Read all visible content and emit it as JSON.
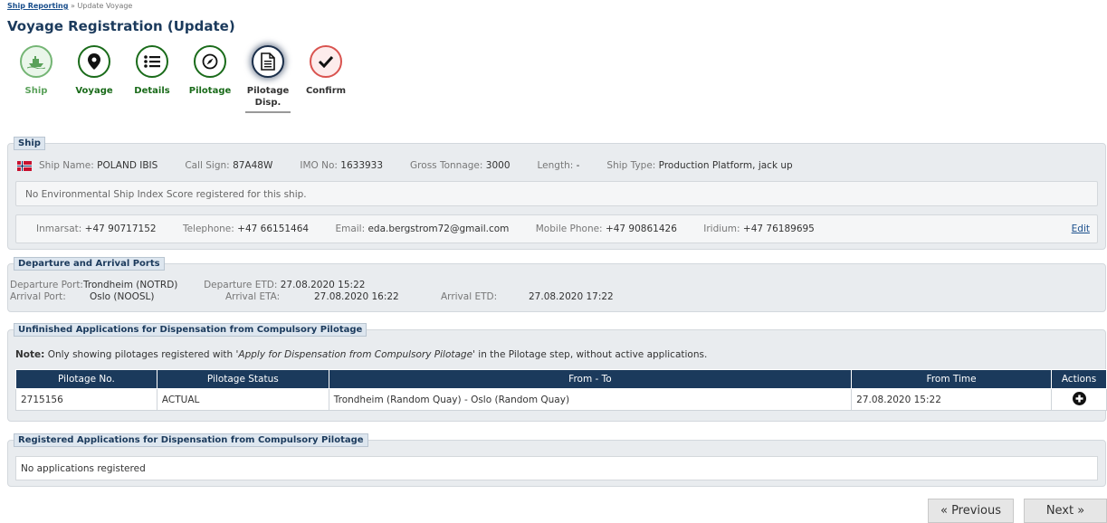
{
  "breadcrumb": {
    "link": "Ship Reporting",
    "separator": "»",
    "current": "Update Voyage"
  },
  "page_title": "Voyage Registration (Update)",
  "steps": [
    {
      "label": "Ship",
      "icon": "ship-icon",
      "state": "done"
    },
    {
      "label": "Voyage",
      "icon": "map-pin-icon",
      "state": "done"
    },
    {
      "label": "Details",
      "icon": "list-icon",
      "state": "done"
    },
    {
      "label": "Pilotage",
      "icon": "compass-icon",
      "state": "done"
    },
    {
      "label": "Pilotage",
      "label2": "Disp.",
      "icon": "document-icon",
      "state": "active"
    },
    {
      "label": "Confirm",
      "icon": "check-icon",
      "state": "pending"
    }
  ],
  "ship": {
    "legend": "Ship",
    "flag": "norway-flag",
    "name_k": "Ship Name:",
    "name_v": "POLAND IBIS",
    "call_k": "Call Sign:",
    "call_v": "87A48W",
    "imo_k": "IMO No:",
    "imo_v": "1633933",
    "gt_k": "Gross Tonnage:",
    "gt_v": "3000",
    "len_k": "Length:",
    "len_v": "-",
    "type_k": "Ship Type:",
    "type_v": "Production Platform, jack up",
    "env_note": "No Environmental Ship Index Score registered for this ship.",
    "inm_k": "Inmarsat:",
    "inm_v": "+47 90717152",
    "tel_k": "Telephone:",
    "tel_v": "+47 66151464",
    "email_k": "Email:",
    "email_v": "eda.bergstrom72@gmail.com",
    "mob_k": "Mobile Phone:",
    "mob_v": "+47 90861426",
    "iri_k": "Iridium:",
    "iri_v": "+47 76189695",
    "edit": "Edit"
  },
  "ports": {
    "legend": "Departure and Arrival Ports",
    "dep_port_k": "Departure Port:",
    "dep_port_v": "Trondheim (NOTRD)",
    "dep_etd_k": "Departure ETD:",
    "dep_etd_v": "27.08.2020 15:22",
    "arr_port_k": "Arrival Port:",
    "arr_port_v": "Oslo (NOOSL)",
    "arr_eta_k": "Arrival ETA:",
    "arr_eta_v": "27.08.2020 16:22",
    "arr_etd_k": "Arrival ETD:",
    "arr_etd_v": "27.08.2020 17:22"
  },
  "unfinished": {
    "legend": "Unfinished Applications for Dispensation from Compulsory Pilotage",
    "note_label": "Note:",
    "note_pre": "Only showing pilotages registered with '",
    "note_em": "Apply for Dispensation from Compulsory Pilotage",
    "note_post": "' in the Pilotage step, without active applications.",
    "columns": [
      "Pilotage No.",
      "Pilotage Status",
      "From - To",
      "From Time",
      "Actions"
    ],
    "rows": [
      {
        "no": "2715156",
        "status": "ACTUAL",
        "from_to": "Trondheim (Random Quay) - Oslo (Random Quay)",
        "from_time": "27.08.2020 15:22"
      }
    ]
  },
  "registered": {
    "legend": "Registered Applications for Dispensation from Compulsory Pilotage",
    "empty": "No applications registered"
  },
  "nav": {
    "previous": "« Previous",
    "next": "Next »"
  }
}
